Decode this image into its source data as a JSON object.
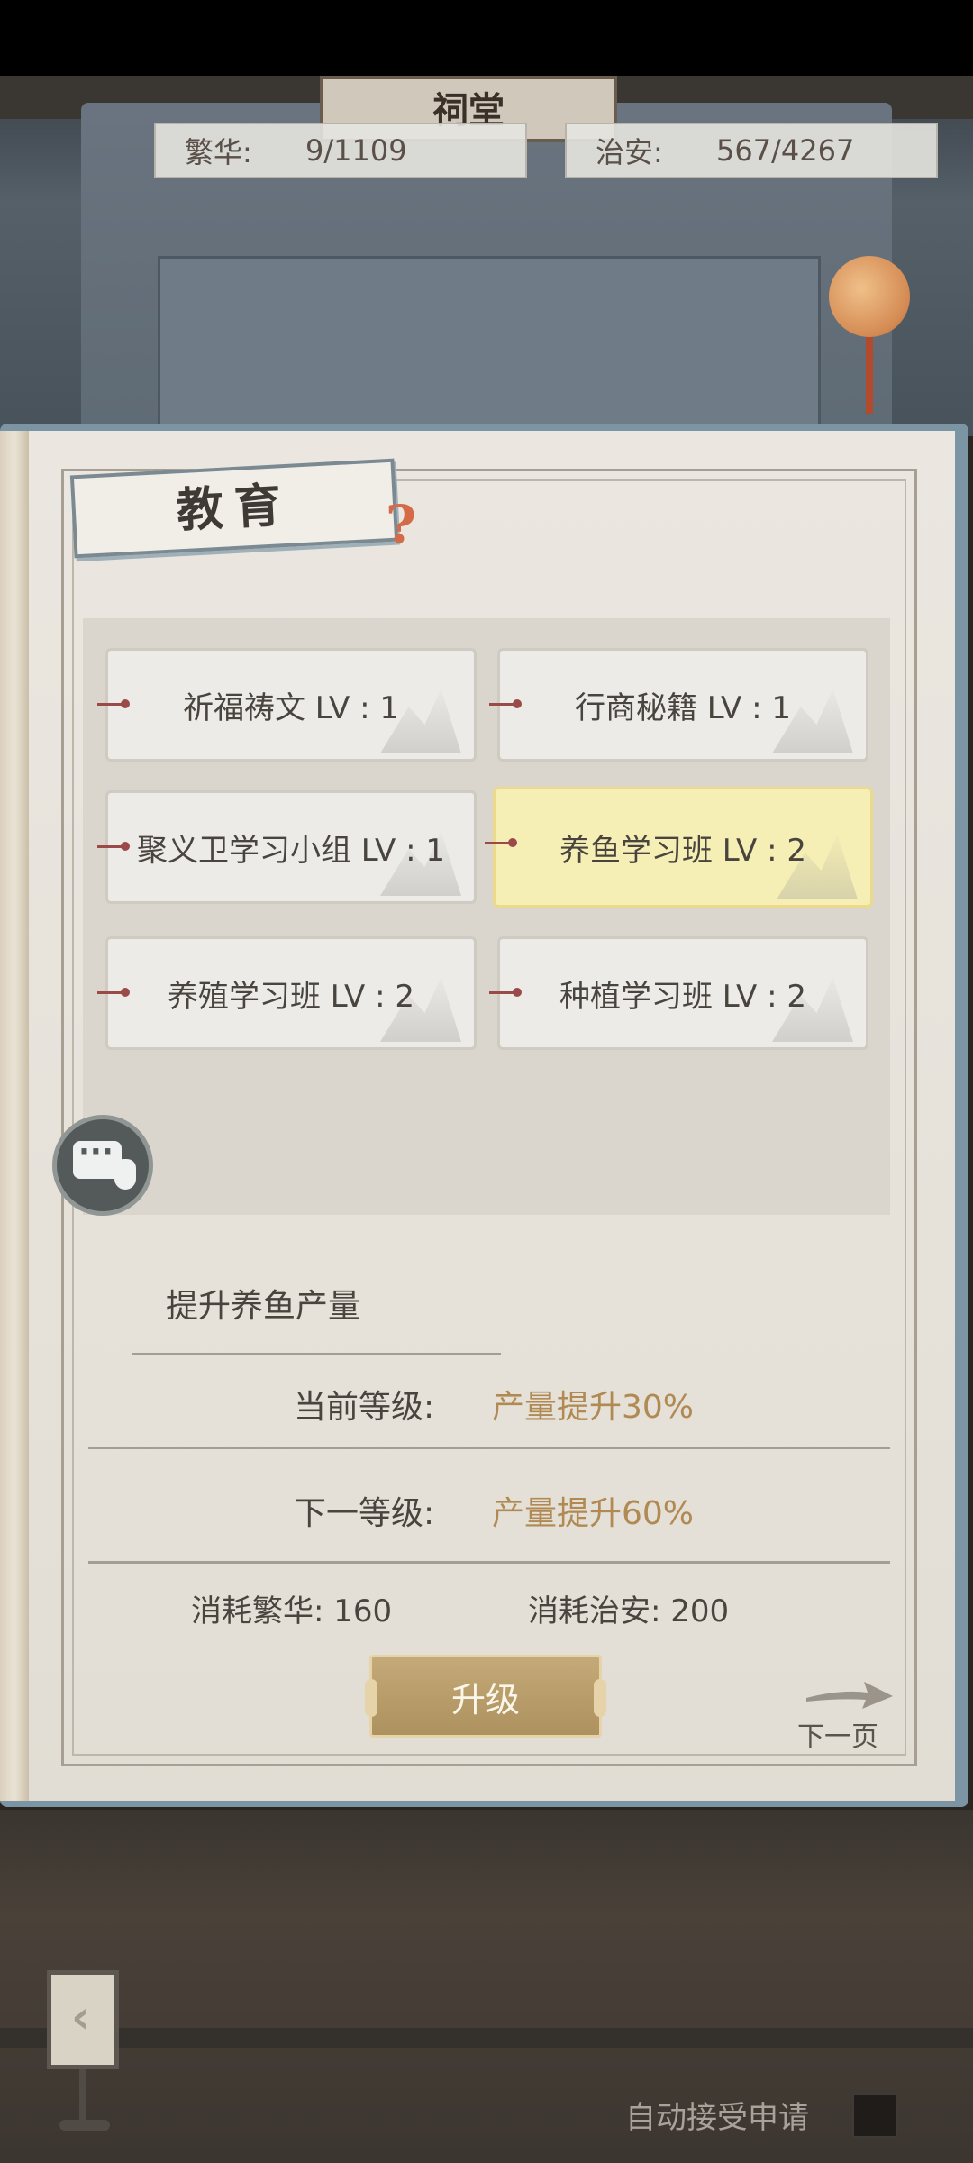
{
  "scene": {
    "hall_sign": "祠堂"
  },
  "resources": {
    "prosperity": {
      "label": "繁华:",
      "value": "9/1109"
    },
    "order": {
      "label": "治安:",
      "value": "567/4267"
    }
  },
  "panel": {
    "title": "教育",
    "title_mark": "?",
    "skills": [
      {
        "name": "祈福祷文 LV : 1",
        "selected": false
      },
      {
        "name": "行商秘籍 LV : 1",
        "selected": false
      },
      {
        "name": "聚义卫学习小组 LV : 1",
        "selected": false
      },
      {
        "name": "养鱼学习班 LV : 2",
        "selected": true
      },
      {
        "name": "养殖学习班 LV : 2",
        "selected": false
      },
      {
        "name": "种植学习班 LV : 2",
        "selected": false
      }
    ]
  },
  "detail": {
    "description": "提升养鱼产量",
    "current_level_label": "当前等级:",
    "current_level_value": "产量提升30%",
    "next_level_label": "下一等级:",
    "next_level_value": "产量提升60%",
    "cost_prosperity": "消耗繁华: 160",
    "cost_order": "消耗治安: 200",
    "upgrade_label": "升级",
    "next_page_label": "下一页"
  },
  "footer": {
    "auto_accept_label": "自动接受申请",
    "auto_accept_checked": false
  },
  "colors": {
    "highlight": "#f5efb5",
    "value_gold": "#b08a52",
    "button_gold": "#b89a68"
  },
  "icons": [
    "chat-icon",
    "lantern-icon",
    "next-arrow-icon",
    "lamp-back-icon",
    "checkbox-icon"
  ]
}
